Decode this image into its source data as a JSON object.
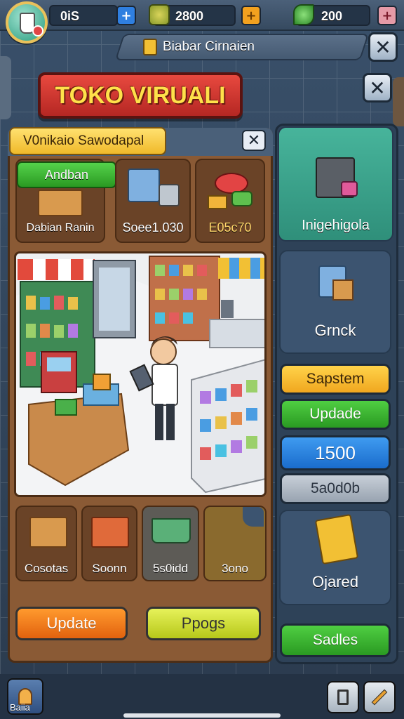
{
  "topbar": {
    "res1": {
      "value": "0iS",
      "plus": "+"
    },
    "res2": {
      "value": "2800",
      "plus": "+"
    },
    "res3": {
      "value": "200",
      "plus": "+"
    }
  },
  "header": {
    "shop_name": "Biabar Cirnaien",
    "close": "✕",
    "close2": "✕"
  },
  "title": "TOKO VIRUALI",
  "panel": {
    "tab_label": "V0nikaio Sawodapal",
    "tab_close": "✕",
    "green_pill": "Andban",
    "cards_top": [
      {
        "label": "Dabian Ranin"
      },
      {
        "label": "Soee1.030"
      },
      {
        "label": "E05c70"
      }
    ],
    "cards_bottom": [
      {
        "label": "Cosotas"
      },
      {
        "label": "Soonn"
      },
      {
        "label": "5s0idd"
      },
      {
        "label": "3ono"
      }
    ],
    "btn_update": "Update",
    "btn_ppogs": "Ppogs"
  },
  "right": {
    "tile1": "Inigehigola",
    "tile2": "Grnck",
    "btn_sapstem": "Sapstem",
    "btn_updade": "Updade",
    "btn_1500": "1500",
    "btn_gray": "5a0d0b",
    "tile3": "Ojared",
    "btn_sadles": "Sadles"
  },
  "bottom": {
    "left_label": "Baiia"
  },
  "colors": {
    "title_red": "#d23630",
    "title_text": "#ffe14a",
    "green": "#3fbf36",
    "orange": "#f07f19",
    "lime": "#cfe12b",
    "blue": "#1f83dd",
    "teal": "#3aa58f"
  }
}
